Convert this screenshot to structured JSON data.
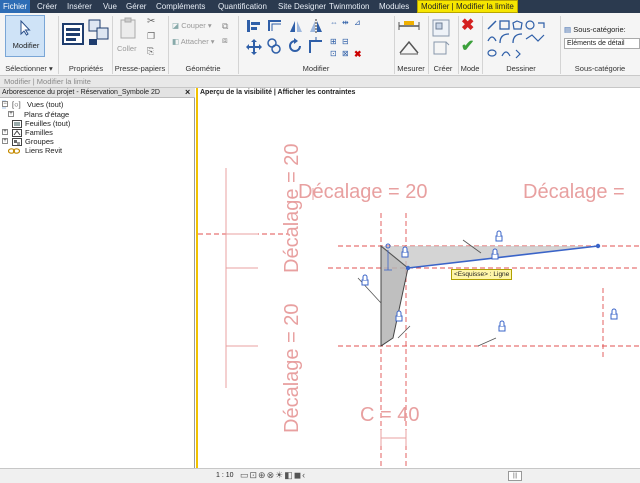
{
  "tabs": [
    "Fichier",
    "Créer",
    "Insérer",
    "Vue",
    "Gérer",
    "Compléments",
    "Quantification",
    "Site Designer",
    "Twinmotion",
    "Modules",
    "Modifier | Modifier la limite"
  ],
  "ribbon": {
    "modifier_label": "Modifier",
    "coller_label": "Coller",
    "couper_label": "Couper",
    "attacher_label": "Attacher",
    "souscat_label": "Sous-catégorie:",
    "souscat_value": "Eléments de détail",
    "panels": {
      "selectionner": "Sélectionner",
      "proprietes": "Propriétés",
      "presse_papiers": "Presse-papiers",
      "geometrie": "Géométrie",
      "modifier": "Modifier",
      "mesurer": "Mesurer",
      "creer": "Créer",
      "mode": "Mode",
      "dessiner": "Dessiner",
      "sous_categorie": "Sous-catégorie"
    }
  },
  "options_bar": "Modifier | Modifier la limite",
  "browser": {
    "title": "Arborescence du projet - Réservation_Symbole 2D",
    "close": "×",
    "items": [
      {
        "label": "Vues (tout)",
        "expander": "−"
      },
      {
        "label": "Plans d'étage",
        "expander": "+"
      },
      {
        "label": "Feuilles (tout)",
        "expander": ""
      },
      {
        "label": "Familles",
        "expander": "+"
      },
      {
        "label": "Groupes",
        "expander": "+"
      },
      {
        "label": "Liens Revit",
        "expander": ""
      }
    ]
  },
  "canvas": {
    "title": "Aperçu de la visibilité | Afficher les contraintes",
    "dim1": "Décalage = 20",
    "dim2": "Décalage =",
    "dim_vertical_1": "Décalage = 20",
    "dim_vertical_2": "Décalage = 20",
    "dim_c": "C = 40",
    "tooltip": "<Esquisse> : Ligne",
    "colors": {
      "dimension_red": "#e8a0a0",
      "ref_line": "#e05050",
      "sketch_blue": "#3a64c8",
      "fill_grey": "#b4b4b4"
    }
  },
  "viewbar": {
    "scale": "1 : 10"
  }
}
